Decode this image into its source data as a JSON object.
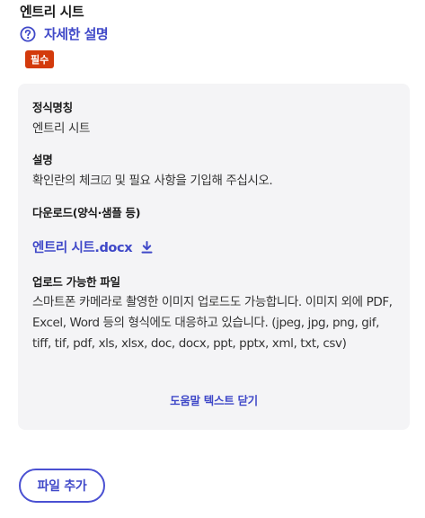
{
  "section": {
    "title": "엔트리 시트",
    "help_link_label": "자세한 설명",
    "required_badge": "필수"
  },
  "help_panel": {
    "official_name_label": "정식명칭",
    "official_name_value": "엔트리 시트",
    "description_label": "설명",
    "description_value": "확인란의 체크☑ 및 필요 사항을 기입해 주십시오.",
    "download_label": "다운로드(양식·샘플 등)",
    "download_file": "엔트리 시트.docx",
    "uploadable_label": "업로드 가능한 파일",
    "uploadable_value": "스마트폰 카메라로 촬영한 이미지 업로드도 가능합니다. 이미지 외에 PDF, Excel, Word 등의 형식에도 대응하고 있습니다. (jpeg, jpg, png, gif, tiff, tif, pdf, xls, xlsx, doc, docx, ppt, pptx, xml, txt, csv)",
    "close_label": "도움말 텍스트 닫기"
  },
  "actions": {
    "add_file_label": "파일 추가"
  },
  "colors": {
    "accent": "#3f48c8",
    "badge": "#d33a0c",
    "panel_bg": "#f4f4f6"
  },
  "icons": {
    "help": "question-circle-icon",
    "download": "download-arrow-icon"
  }
}
